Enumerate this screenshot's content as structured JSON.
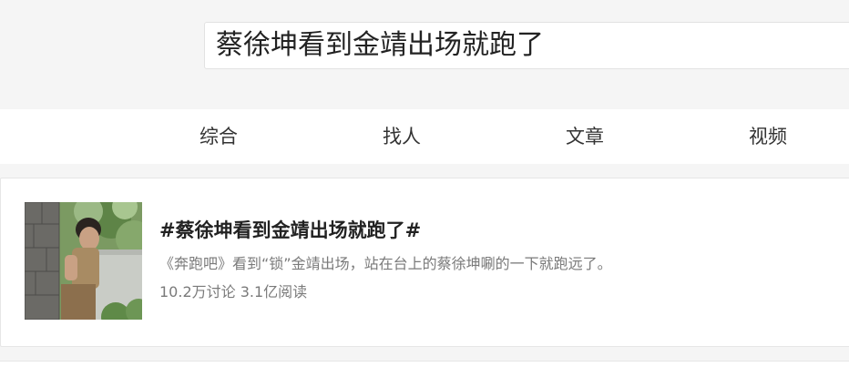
{
  "search": {
    "query": "蔡徐坤看到金靖出场就跑了"
  },
  "tabs": [
    {
      "label": "综合"
    },
    {
      "label": "找人"
    },
    {
      "label": "文章"
    },
    {
      "label": "视频"
    }
  ],
  "result": {
    "title": "#蔡徐坤看到金靖出场就跑了#",
    "description": "《奔跑吧》看到“锁”金靖出场，站在台上的蔡徐坤唰的一下就跑远了。",
    "stats": "10.2万讨论 3.1亿阅读",
    "thumbnail_icon": "video-still-thumbnail"
  }
}
